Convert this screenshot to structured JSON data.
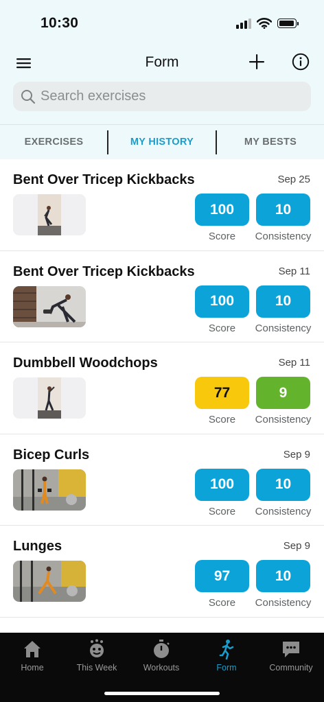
{
  "status": {
    "time": "10:30"
  },
  "header": {
    "title": "Form"
  },
  "search": {
    "placeholder": "Search exercises"
  },
  "tabs": [
    {
      "label": "EXERCISES",
      "active": false
    },
    {
      "label": "MY HISTORY",
      "active": true
    },
    {
      "label": "MY BESTS",
      "active": false
    }
  ],
  "history": [
    {
      "name": "Bent Over Tricep Kickbacks",
      "date": "Sep 25",
      "score": "100",
      "consistency": "10",
      "score_label": "Score",
      "consistency_label": "Consistency",
      "score_color": "#0ca3d9",
      "consistency_color": "#0ca3d9"
    },
    {
      "name": "Bent Over Tricep Kickbacks",
      "date": "Sep 11",
      "score": "100",
      "consistency": "10",
      "score_label": "Score",
      "consistency_label": "Consistency",
      "score_color": "#0ca3d9",
      "consistency_color": "#0ca3d9"
    },
    {
      "name": "Dumbbell Woodchops",
      "date": "Sep 11",
      "score": "77",
      "consistency": "9",
      "score_label": "Score",
      "consistency_label": "Consistency",
      "score_color": "#f7c80c",
      "consistency_color": "#63b32d"
    },
    {
      "name": "Bicep Curls",
      "date": "Sep 9",
      "score": "100",
      "consistency": "10",
      "score_label": "Score",
      "consistency_label": "Consistency",
      "score_color": "#0ca3d9",
      "consistency_color": "#0ca3d9"
    },
    {
      "name": "Lunges",
      "date": "Sep 9",
      "score": "97",
      "consistency": "10",
      "score_label": "Score",
      "consistency_label": "Consistency",
      "score_color": "#0ca3d9",
      "consistency_color": "#0ca3d9"
    }
  ],
  "nav": [
    {
      "label": "Home",
      "icon": "home-icon"
    },
    {
      "label": "This Week",
      "icon": "trophy-face-icon"
    },
    {
      "label": "Workouts",
      "icon": "stopwatch-icon"
    },
    {
      "label": "Form",
      "icon": "running-figure-icon",
      "active": true
    },
    {
      "label": "Community",
      "icon": "chat-bubble-icon"
    }
  ],
  "colors": {
    "accent": "#1a9dcc",
    "score_blue": "#0ca3d9",
    "yellow": "#f7c80c",
    "green": "#63b32d"
  }
}
